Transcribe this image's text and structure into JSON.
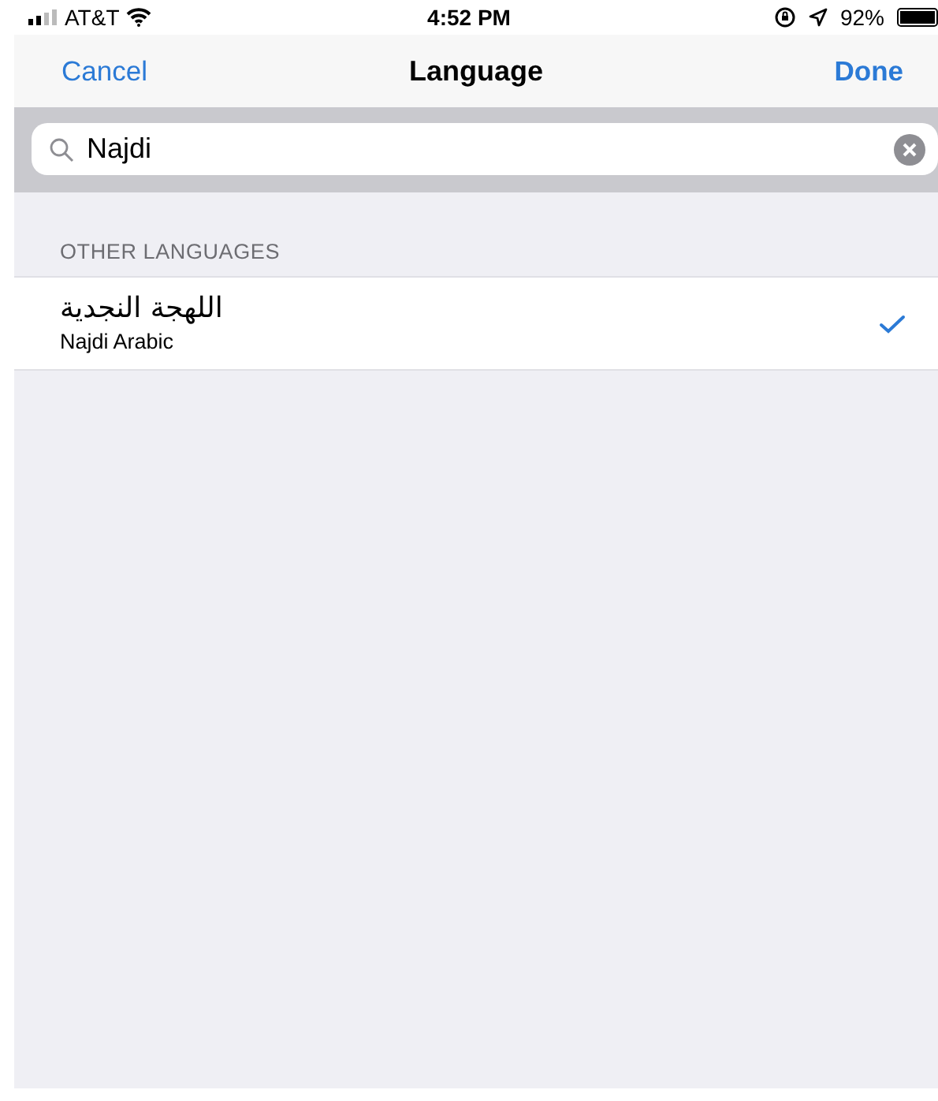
{
  "status_bar": {
    "carrier": "AT&T",
    "time": "4:52 PM",
    "battery": "92%"
  },
  "nav_bar": {
    "left_button": "Cancel",
    "title": "Language",
    "right_button": "Done"
  },
  "search": {
    "value": "Najdi"
  },
  "section": {
    "header": "OTHER LANGUAGES",
    "rows": [
      {
        "native": "اللهجة النجدية",
        "english": "Najdi Arabic",
        "selected": true
      }
    ]
  }
}
